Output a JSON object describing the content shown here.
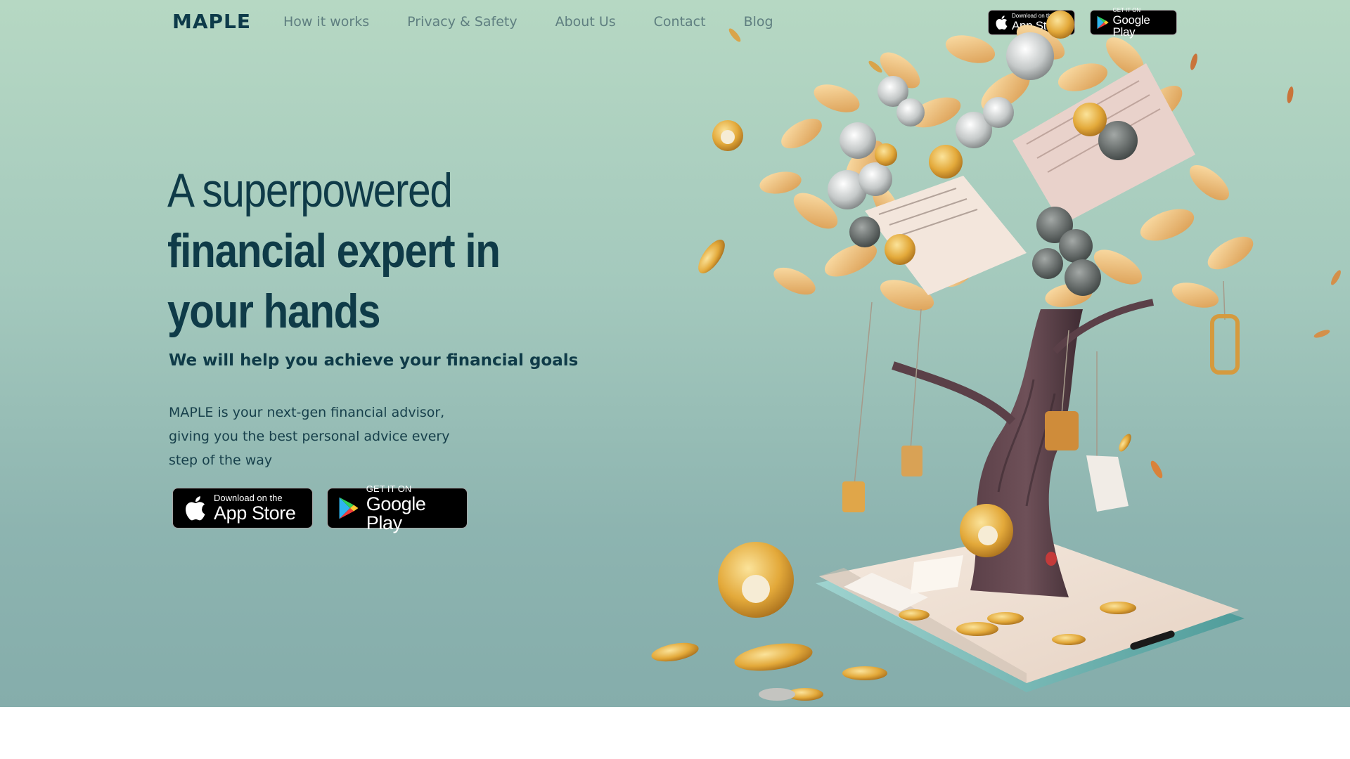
{
  "brand": {
    "name": "MAPLE"
  },
  "nav": {
    "links": [
      "How it works",
      "Privacy & Safety",
      "About Us",
      "Contact",
      "Blog"
    ]
  },
  "badges": {
    "app_store": {
      "line1": "Download on the",
      "line2": "App Store",
      "icon": "apple-icon"
    },
    "google_play": {
      "line1": "GET IT ON",
      "line2": "Google Play",
      "icon": "google-play-icon"
    }
  },
  "hero": {
    "headline_line1": "A superpowered",
    "headline_line2": "financial expert in",
    "headline_line3": "your hands",
    "subheading": "We will help you achieve your financial goals",
    "description_line1": "MAPLE is your next-gen financial advisor,",
    "description_line2": "giving you the best personal advice every",
    "description_line3": "step of the way"
  },
  "colors": {
    "hero_gradient_top": "#b6d8c3",
    "hero_gradient_bottom": "#85adab",
    "heading": "#0f3b48",
    "nav_link": "#5f7f80"
  }
}
